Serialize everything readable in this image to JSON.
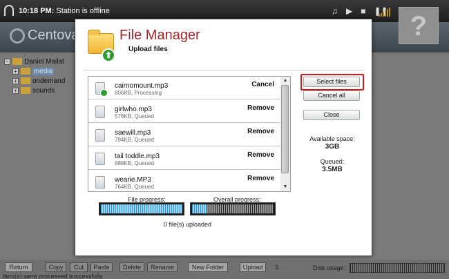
{
  "topbar": {
    "time": "10:18 PM:",
    "status": "Station is offline",
    "player_icons": [
      "music-note-icon",
      "play-icon",
      "stop-icon",
      "pause-icon"
    ],
    "help_glyph": "?"
  },
  "header": {
    "logo_text": "Centova"
  },
  "tree": {
    "root": "Daniel Mailat",
    "folders": [
      {
        "label": "media",
        "selected": true
      },
      {
        "label": "ondemand",
        "selected": false
      },
      {
        "label": "sounds",
        "selected": false
      }
    ]
  },
  "bottombar": {
    "buttons": [
      "Return",
      "Copy",
      "Cut",
      "Paste",
      "Delete",
      "Rename",
      "New Folder",
      "Upload"
    ],
    "upload_count": "3",
    "status": "item(s) were processed successfully",
    "disk_usage_label": "Disk usage:"
  },
  "modal": {
    "title": "File Manager",
    "subtitle": "Upload files",
    "files": [
      {
        "name": "cairnomount.mp3",
        "meta": "806KB, Processing",
        "action": "Cancel",
        "uploading": true
      },
      {
        "name": "girlwho.mp3",
        "meta": "576KB, Queued",
        "action": "Remove",
        "uploading": false
      },
      {
        "name": "saewill.mp3",
        "meta": "794KB, Queued",
        "action": "Remove",
        "uploading": false
      },
      {
        "name": "tail toddle.mp3",
        "meta": "688KB, Queued",
        "action": "Remove",
        "uploading": false
      },
      {
        "name": "wearie.MP3",
        "meta": "764KB, Queued",
        "action": "Remove",
        "uploading": false
      }
    ],
    "file_progress_label": "File progress:",
    "file_progress_fraction": 1.0,
    "overall_progress_label": "Overall progress:",
    "overall_progress_fraction": 0.18,
    "uploaded_text": "0 file(s) uploaded",
    "buttons": {
      "select": "Select files",
      "cancel_all": "Cancel all",
      "close": "Close"
    },
    "available_space_label": "Available space:",
    "available_space_value": "3GB",
    "queued_label": "Queued:",
    "queued_value": "3.5MB",
    "highlight_color": "#d8141c",
    "title_color": "#a3262a"
  }
}
